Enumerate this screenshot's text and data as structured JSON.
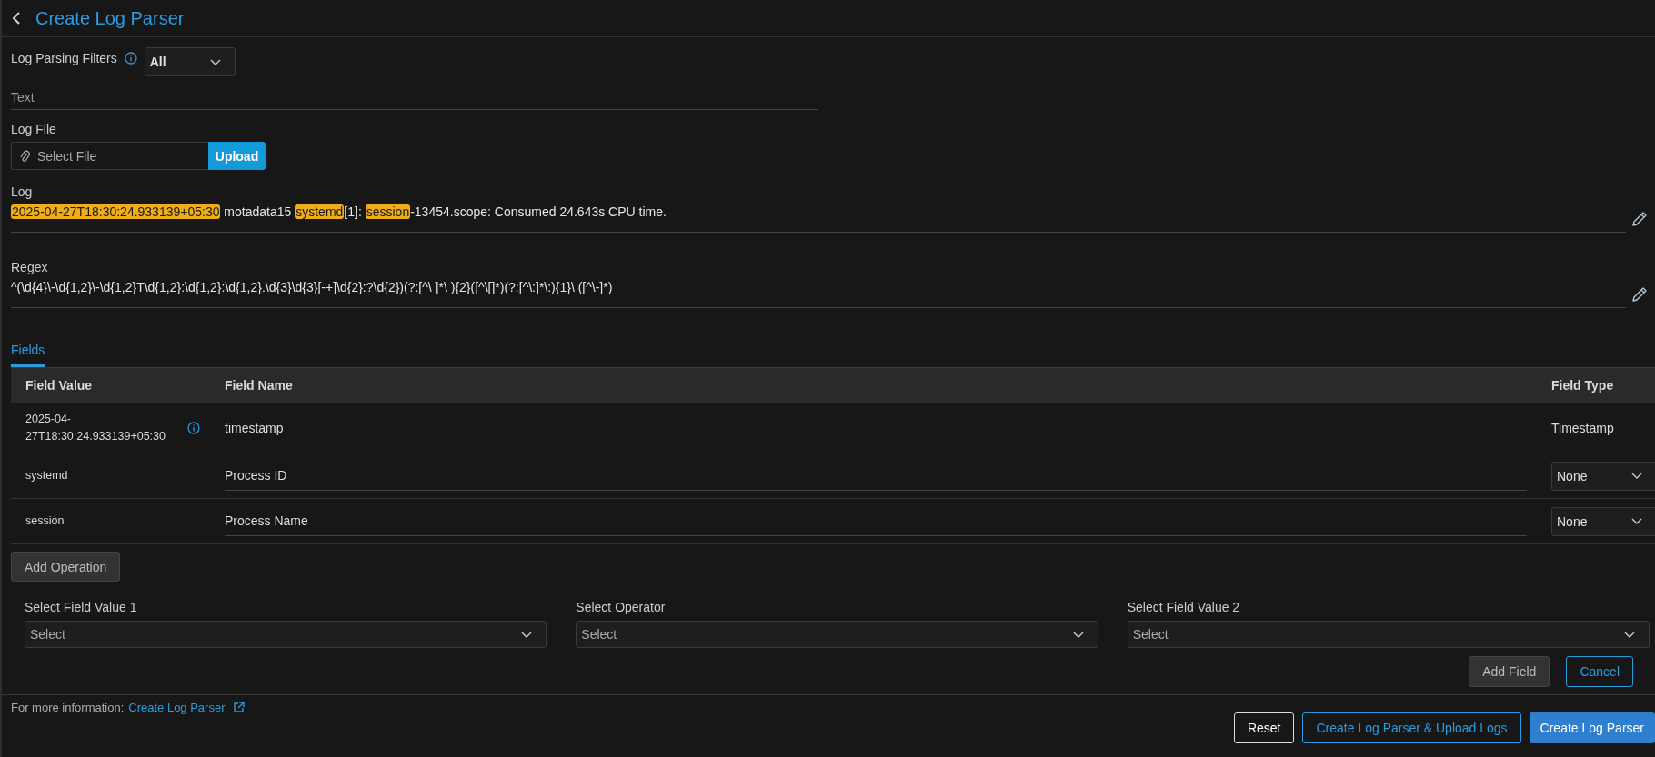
{
  "header": {
    "title": "Create Log Parser"
  },
  "filters": {
    "label": "Log Parsing Filters",
    "value": "All"
  },
  "text_field": {
    "placeholder": "Text"
  },
  "log_file": {
    "label": "Log File",
    "placeholder": "Select File",
    "button": "Upload"
  },
  "log": {
    "label": "Log",
    "segments": [
      {
        "text": "2025-04-27T18:30:24.933139+05:30",
        "highlighted": true
      },
      {
        "text": " motadata15 ",
        "highlighted": false
      },
      {
        "text": "systemd",
        "highlighted": true
      },
      {
        "text": "[1]: ",
        "highlighted": false
      },
      {
        "text": "session",
        "highlighted": true
      },
      {
        "text": "-13454.scope: Consumed 24.643s CPU time.",
        "highlighted": false
      }
    ]
  },
  "regex": {
    "label": "Regex",
    "value": "^(\\d{4}\\-\\d{1,2}\\-\\d{1,2}T\\d{1,2}:\\d{1,2}:\\d{1,2}.\\d{3}\\d{3}[-+]\\d{2}:?\\d{2})(?:[^\\ ]*\\ ){2}([^\\[]*)(?:[^\\:]*\\:){1}\\ ([^\\-]*)"
  },
  "tabs": [
    {
      "label": "Fields",
      "selected": true
    }
  ],
  "fields": {
    "columns": [
      "Field Value",
      "Field Name",
      "Field Type"
    ],
    "rows": [
      {
        "value": "2025-04-27T18:30:24.933139+05:30",
        "info": true,
        "name": "timestamp",
        "type": "Timestamp",
        "kind": "text"
      },
      {
        "value": "systemd",
        "info": false,
        "name": "Process ID",
        "type": "None",
        "kind": "select"
      },
      {
        "value": "session",
        "info": false,
        "name": "Process Name",
        "type": "None",
        "kind": "select"
      }
    ]
  },
  "add_operation": "Add Operation",
  "operation": {
    "selects": [
      {
        "label": "Select Field Value 1",
        "placeholder": "Select"
      },
      {
        "label": "Select Operator",
        "placeholder": "Select"
      },
      {
        "label": "Select Field Value 2",
        "placeholder": "Select"
      }
    ],
    "buttons": [
      {
        "label": "Add Field",
        "kind": "secondary"
      },
      {
        "label": "Cancel",
        "kind": "outline"
      }
    ]
  },
  "footer": {
    "info_text": "For more information:",
    "link": "Create Log Parser",
    "buttons": [
      {
        "label": "Reset",
        "kind": "plain"
      },
      {
        "label": "Create Log Parser & Upload Logs",
        "kind": "outline"
      },
      {
        "label": "Create Log Parser",
        "kind": "primary"
      }
    ]
  }
}
